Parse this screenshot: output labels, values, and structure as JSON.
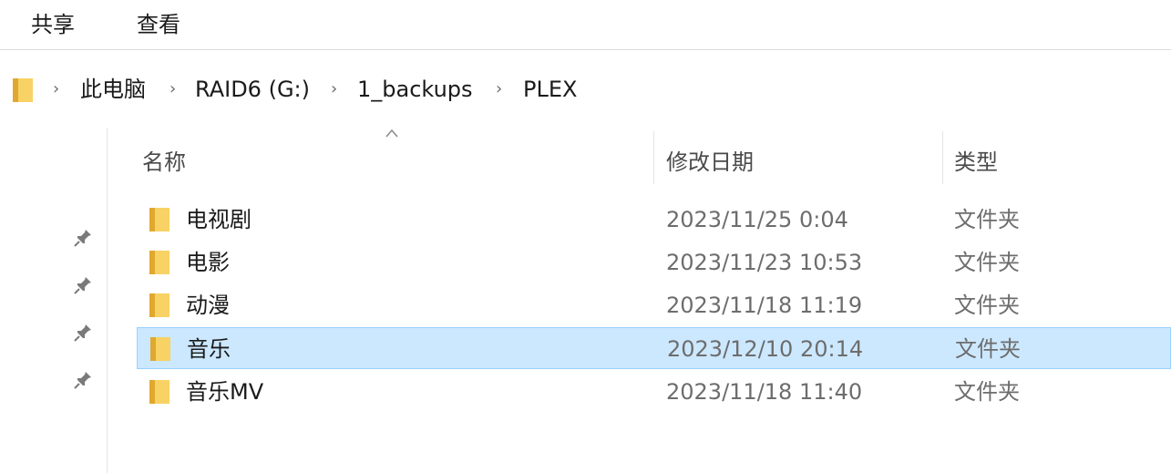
{
  "ribbon": {
    "tabs": [
      "共享",
      "查看"
    ]
  },
  "address": {
    "crumbs": [
      "此电脑",
      "RAID6 (G:)",
      "1_backups",
      "PLEX"
    ],
    "separator": "›"
  },
  "columns": {
    "name": "名称",
    "modified": "修改日期",
    "type": "类型"
  },
  "files": [
    {
      "name": "电视剧",
      "modified": "2023/11/25 0:04",
      "type": "文件夹",
      "selected": false
    },
    {
      "name": "电影",
      "modified": "2023/11/23 10:53",
      "type": "文件夹",
      "selected": false
    },
    {
      "name": "动漫",
      "modified": "2023/11/18 11:19",
      "type": "文件夹",
      "selected": false
    },
    {
      "name": "音乐",
      "modified": "2023/12/10 20:14",
      "type": "文件夹",
      "selected": true
    },
    {
      "name": "音乐MV",
      "modified": "2023/11/18 11:40",
      "type": "文件夹",
      "selected": false
    }
  ],
  "icons": {
    "folder": "folder-icon",
    "pin": "pin-icon",
    "sort": "sort-ascending-icon"
  },
  "colors": {
    "selection_bg": "#cce8ff",
    "selection_border": "#99d1ff",
    "folder_yellow": "#f8d264",
    "folder_dark": "#e0a82e"
  }
}
